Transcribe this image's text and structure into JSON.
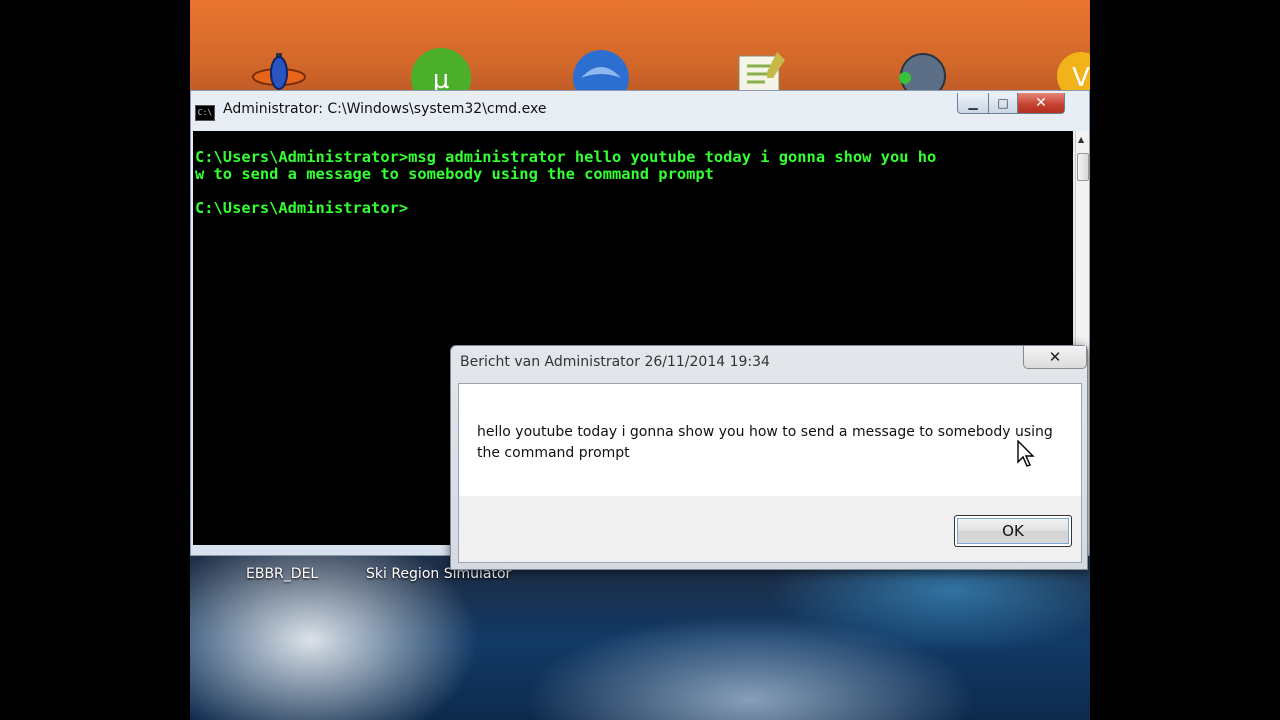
{
  "cmd_window": {
    "title": "Administrator: C:\\Windows\\system32\\cmd.exe",
    "icon_text": "C:\\",
    "console_lines": "C:\\Users\\Administrator>msg administrator hello youtube today i gonna show you ho\nw to send a message to somebody using the command prompt\n\nC:\\Users\\Administrator>",
    "text_color": "#33ff33",
    "minimize_label": "▁",
    "maximize_label": "□",
    "close_label": "✕"
  },
  "message_dialog": {
    "title": "Bericht van Administrator 26/11/2014 19:34",
    "message": "hello youtube today i gonna show you how to send a message to somebody using the command prompt",
    "ok_label": "OK",
    "close_label": "✕"
  },
  "desktop": {
    "taskbar_items": [
      {
        "label": "EBBR_DEL"
      },
      {
        "label": "Ski Region Simulator"
      }
    ],
    "icons": [
      "plane-icon",
      "utorrent-icon",
      "thunderbird-icon",
      "notepad-icon",
      "media-player-icon",
      "v-app-icon"
    ]
  }
}
